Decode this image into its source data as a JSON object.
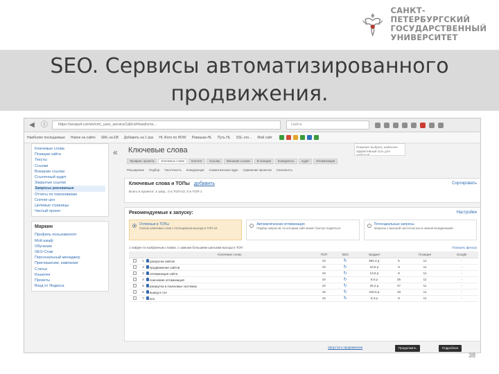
{
  "university": {
    "lines": [
      "САНКТ-ПЕТЕРБУРГСКИЙ",
      "ГОСУДАРСТВЕННЫЙ",
      "УНИВЕРСИТЕТ"
    ]
  },
  "slide": {
    "title_line1": "SEO. Сервисы автоматизированного",
    "title_line2": "продвижения.",
    "page_number": "38"
  },
  "browser": {
    "url": "https://seopult.ru/mm/cm/_user_service/1&lt;id=kwd/cms...",
    "search_placeholder": "Найти"
  },
  "bookmarks": [
    "Наиболее посещаемые",
    "Новое на сайте",
    "SML на ЕВ",
    "Добавить на 1 раз",
    "HL Фото по HDW",
    "Ромашка-HL",
    "Путь HL",
    "SSL-это...",
    "Мой сайт"
  ],
  "sidebar": {
    "top_items": [
      "Ключевые слова",
      "Позиции сайта",
      "Тексты",
      "Ссылки",
      "Внешние ссылки",
      "Ссылочный аудит",
      "Закрытые ссылки",
      "Запросы рекламные",
      "Отчеты по поисковикам",
      "Снятие цен",
      "Целевые страницы",
      "Чистый проект"
    ],
    "active_index": 7,
    "group_title": "Маркин",
    "group_items": [
      "Профиль пользователя",
      "Мой шкаф",
      "Обучение",
      "SEO-Стаж",
      "Персональный менеджер",
      "Приглашение, кампании",
      "Статьи",
      "Кошелек",
      "Проекты",
      "Вход от Яндекса"
    ]
  },
  "main": {
    "heading": "Ключевые слова",
    "help_note": "Помогает выбрать наиболее эффективный путь для запросов",
    "tabs": [
      "Профиль проекта",
      "Ключевые слова",
      "Контент",
      "Ссылки",
      "Внешние ссылки",
      "В позиции",
      "Конкуренты",
      "Аудит",
      "Оптимизация"
    ],
    "subtabs": [
      "Расширение",
      "Подбор",
      "Частотность",
      "Конкуренция",
      "Семантическое ядро",
      "Сравнение проектов",
      "Сезонность"
    ],
    "kw_panel_title": "Ключевые слова и ТОПы",
    "kw_panel_add": "добавить",
    "kw_panel_link": "Сортировать",
    "kw_panel_text": "Всего в проекте: 3 запр., 0 в ТОП-10, 0 в ТОП-1",
    "rec_title": "Рекомендуемые к запуску:",
    "rec_link": "Настройки",
    "rec_cards": [
      {
        "name": "Отличные в ТОПы",
        "desc": "Список ключевых слов с потенциалом выхода в ТОП-10"
      },
      {
        "name": "Автоматическая оптимизация",
        "desc": "Подбор запросов, по которым сайт может быстро подняться"
      },
      {
        "name": "Потенциальные запросы",
        "desc": "Запросы с высокой частотностью и низкой конкуренцией"
      }
    ],
    "filter_text": "1 найден по выбранным словам, с самыми большими шансами выхода в ТОП",
    "filter_more": "Показать фильтр",
    "table_headers": [
      "",
      "",
      "Ключевое слово",
      "ТОП",
      "SEO",
      "",
      "Бюджет",
      "",
      "Позиция",
      "Google"
    ],
    "rows": [
      {
        "n": "1",
        "kw": "раскрутка сайтов",
        "top": "10",
        "budget": "891,4 р.",
        "f1": "5",
        "pos": "11",
        "g": "-"
      },
      {
        "n": "2",
        "kw": "продвижение сайтов",
        "top": "10",
        "budget": "10,5 р.",
        "f1": "8",
        "pos": "11",
        "g": "-"
      },
      {
        "n": "3",
        "kw": "оптимизация сайта",
        "top": "10",
        "budget": "13,5 р.",
        "f1": "8",
        "pos": "11",
        "g": "-"
      },
      {
        "n": "4",
        "kw": "поисковая оптимизация",
        "top": "10",
        "budget": "5,0 р.",
        "f1": "25",
        "pos": "11",
        "g": "-"
      },
      {
        "n": "5",
        "kw": "раскрутка в поисковых системах",
        "top": "10",
        "budget": "25,2 р.",
        "f1": "47",
        "pos": "11",
        "g": "-"
      },
      {
        "n": "6",
        "kw": "вывод в топ",
        "top": "10",
        "budget": "440,5 р.",
        "f1": "18",
        "pos": "11",
        "g": "-"
      },
      {
        "n": "7",
        "kw": "seo",
        "top": "10",
        "budget": "5,4 р.",
        "f1": "8",
        "pos": "11",
        "g": "-"
      }
    ],
    "footer_link": "Запустить продвижение",
    "footer_btn1": "Продолжить",
    "footer_btn2": "Подробнее"
  }
}
